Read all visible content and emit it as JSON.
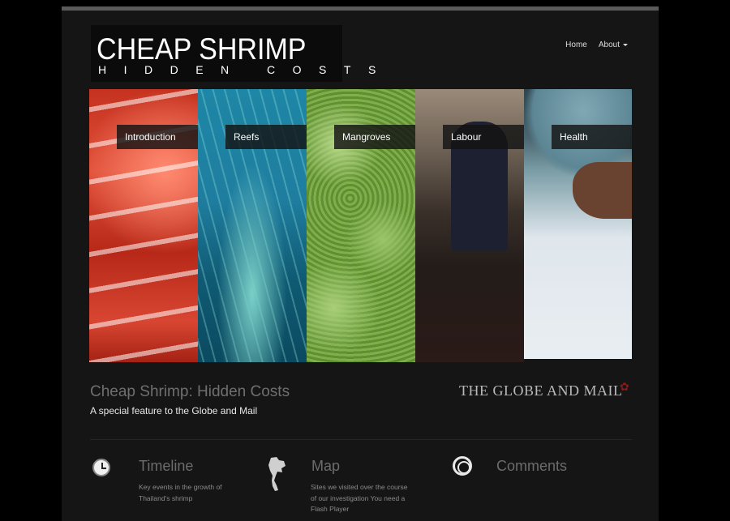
{
  "logo": {
    "title": "CHEAP SHRIMP",
    "subtitle": "HIDDEN COSTS"
  },
  "nav": {
    "home": "Home",
    "about": "About"
  },
  "panels": [
    {
      "label": "Introduction"
    },
    {
      "label": "Reefs"
    },
    {
      "label": "Mangroves"
    },
    {
      "label": "Labour"
    },
    {
      "label": "Health"
    }
  ],
  "feature": {
    "title": "Cheap Shrimp: Hidden Costs",
    "subtitle": "A special feature to the Globe and Mail",
    "partner_logo": "THE GLOBE AND MAIL"
  },
  "sections": {
    "timeline": {
      "title": "Timeline",
      "desc_line1": "Key events in the growth of",
      "desc_line2": "Thailand's shrimp"
    },
    "map": {
      "title": "Map",
      "desc_line1": "Sites we visited over the course",
      "desc_line2": "of our investigation You need a",
      "desc_line3": "Flash Player"
    },
    "comments": {
      "title": "Comments"
    }
  },
  "colors": {
    "background": "#000000",
    "page": "#151515",
    "maple": "#8a1a1a"
  }
}
